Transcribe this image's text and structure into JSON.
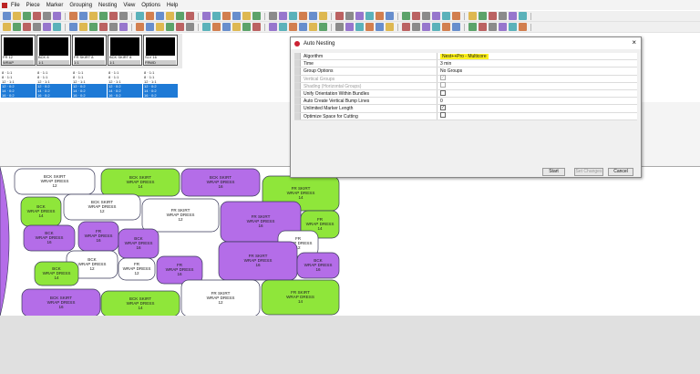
{
  "menu": [
    "File",
    "Piece",
    "Marker",
    "Grouping",
    "Nesting",
    "View",
    "Options",
    "Help"
  ],
  "pieces": [
    {
      "label": "FR 12",
      "sub": "WRAP"
    },
    {
      "label": "BCK 8",
      "sub": "1:1"
    },
    {
      "label": "FR SKIRT 8",
      "sub": "1:1"
    },
    {
      "label": "BCK SKIRT 8",
      "sub": "1:1"
    },
    {
      "label": "SLV 16",
      "sub": "FRWD"
    }
  ],
  "bundles": [
    [
      "8 · 1:1",
      "8 · 1:1",
      "12 · 1:1",
      "12 · 0:2",
      "14 · 0:2",
      "16 · 0:2"
    ],
    [
      "8 · 1:1",
      "8 · 1:1",
      "12 · 1:1",
      "12 · 0:2",
      "14 · 0:2",
      "16 · 0:2"
    ],
    [
      "8 · 1:1",
      "8 · 1:1",
      "12 · 1:1",
      "12 · 0:2",
      "14 · 0:2",
      "16 · 0:2"
    ],
    [
      "8 · 1:1",
      "8 · 1:1",
      "12 · 1:1",
      "12 · 0:2",
      "14 · 0:2",
      "16 · 0:2"
    ],
    [
      "8 · 1:1",
      "8 · 1:1",
      "12 · 1:1",
      "12 · 0:2",
      "14 · 0:2",
      "16 · 0:2"
    ]
  ],
  "dialog": {
    "title": "Auto Nesting",
    "close": "×",
    "rows": [
      {
        "label": "Algorithm",
        "value": "Nest++Pro - Multicore",
        "highlight": true
      },
      {
        "label": "Time",
        "value": "3 min"
      },
      {
        "label": "Group Options",
        "value": "No Groups"
      },
      {
        "label": "Vertical Groups",
        "value": "✓",
        "disabled": true,
        "checkbox": true
      },
      {
        "label": "Shading (Horizontal Groups)",
        "value": "",
        "disabled": true,
        "checkbox": true
      },
      {
        "label": "Unify Orientation Within Bundles",
        "value": "",
        "checkbox": true
      },
      {
        "label": "Auto Create Vertical Bump Lines",
        "value": "0"
      },
      {
        "label": "Unlimited Marker Length",
        "value": "✓",
        "checkbox": true
      },
      {
        "label": "Optimize Space for Cutting",
        "value": "",
        "checkbox": true
      }
    ],
    "start": "Start",
    "set_changes": "Set Changes",
    "cancel": "Cancel"
  },
  "marker": [
    {
      "l1": "BCK SKIRT",
      "l2": "WRAP DRESS",
      "s": "12",
      "c": "white"
    },
    {
      "l1": "BCK SKIRT",
      "l2": "WRAP DRESS",
      "s": "14",
      "c": "green"
    },
    {
      "l1": "BCK SKIRT",
      "l2": "WRAP DRESS",
      "s": "16",
      "c": "purple"
    },
    {
      "l1": "FR SKIRT",
      "l2": "WRAP DRESS",
      "s": "14",
      "c": "green"
    },
    {
      "l1": "BCK",
      "l2": "WRAP DRESS",
      "s": "14",
      "c": "green"
    },
    {
      "l1": "BCK SKIRT",
      "l2": "WRAP DRESS",
      "s": "12",
      "c": "white"
    },
    {
      "l1": "FR SKIRT",
      "l2": "WRAP DRESS",
      "s": "12",
      "c": "white"
    },
    {
      "l1": "FR SKIRT",
      "l2": "WRAP DRESS",
      "s": "16",
      "c": "purple"
    },
    {
      "l1": "BCK",
      "l2": "WRAP DRESS",
      "s": "16",
      "c": "purple"
    },
    {
      "l1": "FR",
      "l2": "WRAP DRESS",
      "s": "16",
      "c": "purple"
    },
    {
      "l1": "BCK",
      "l2": "WRAP DRESS",
      "s": "16",
      "c": "purple"
    },
    {
      "l1": "FR",
      "l2": "WRAP DRESS",
      "s": "14",
      "c": "green"
    },
    {
      "l1": "FR",
      "l2": "WRAP DRESS",
      "s": "12",
      "c": "white"
    },
    {
      "l1": "BCK",
      "l2": "WRAP DRESS",
      "s": "12",
      "c": "white"
    },
    {
      "l1": "FR SKIRT",
      "l2": "WRAP DRESS",
      "s": "16",
      "c": "purple"
    },
    {
      "l1": "FR",
      "l2": "WRAP DRESS",
      "s": "12",
      "c": "white"
    },
    {
      "l1": "BCK",
      "l2": "WRAP DRESS",
      "s": "14",
      "c": "green"
    },
    {
      "l1": "FR",
      "l2": "WRAP DRESS",
      "s": "16",
      "c": "purple"
    },
    {
      "l1": "FR",
      "l2": "WRAP DRESS",
      "s": "14",
      "c": "green"
    },
    {
      "l1": "BCK",
      "l2": "WRAP DRESS",
      "s": "16",
      "c": "purple"
    },
    {
      "l1": "BCK SKIRT",
      "l2": "WRAP DRESS",
      "s": "16",
      "c": "purple"
    },
    {
      "l1": "BCK SKIRT",
      "l2": "WRAP DRESS",
      "s": "14",
      "c": "green"
    },
    {
      "l1": "FR SKIRT",
      "l2": "WRAP DRESS",
      "s": "12",
      "c": "white"
    },
    {
      "l1": "FR SKIRT",
      "l2": "WRAP DRESS",
      "s": "14",
      "c": "green"
    }
  ],
  "colors": {
    "green": "#8fe63a",
    "purple": "#b46de8",
    "white": "#ffffff",
    "outline": "#3a3a5a"
  }
}
